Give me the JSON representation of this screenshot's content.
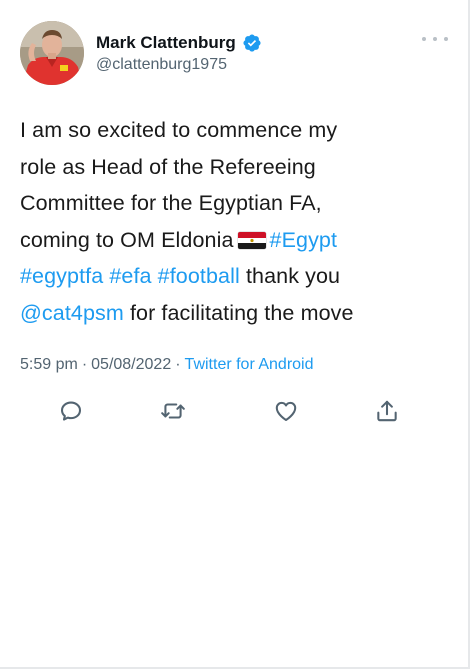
{
  "tweet": {
    "author": {
      "display_name": "Mark Clattenburg",
      "handle": "@clattenburg1975",
      "verified": true,
      "avatar_icon": "avatar-referee-photo"
    },
    "text_lines": [
      [
        {
          "text": "I am so excited to commence my"
        }
      ],
      [
        {
          "text": "role as Head of the Refereeing"
        }
      ],
      [
        {
          "text": "Committee for the Egyptian FA,"
        }
      ],
      [
        {
          "text": "coming to OM Eldonia"
        },
        {
          "emoji": "egypt-flag-icon"
        },
        {
          "text": "#Egypt",
          "link": true
        }
      ],
      [
        {
          "text": "#egyptfa #efa #football",
          "link": true
        },
        {
          "text": " thank you"
        }
      ],
      [
        {
          "text": "@cat4psm",
          "link": true
        },
        {
          "text": " for facilitating the move"
        }
      ]
    ],
    "time": "5:59 pm",
    "date": "05/08/2022",
    "separator": "·",
    "source": "Twitter for Android"
  },
  "actions": {
    "reply_icon": "reply-icon",
    "retweet_icon": "retweet-icon",
    "like_icon": "like-icon",
    "share_icon": "share-icon"
  },
  "colors": {
    "link": "#1d9bf0",
    "text": "#0f1419",
    "secondary": "#536471",
    "icon": "#536471"
  }
}
